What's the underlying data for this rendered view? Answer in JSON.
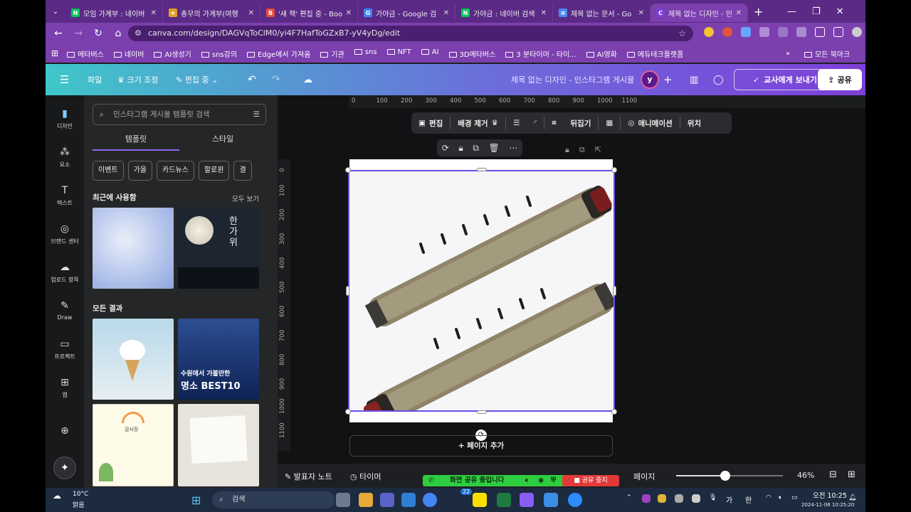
{
  "browser": {
    "tabs": [
      {
        "title": "모임 가계부 : 네이버",
        "fav": "N",
        "color": "#03c75a",
        "active": false
      },
      {
        "title": "총무의 가계부(여행",
        "fav": "★",
        "color": "#e0a020",
        "active": false
      },
      {
        "title": "'새 책' 편집 중 - Boo",
        "fav": "B",
        "color": "#e74c3c",
        "active": false
      },
      {
        "title": "가야금 - Google 검",
        "fav": "G",
        "color": "#4285f4",
        "active": false
      },
      {
        "title": "가야금 : 네이버 검색",
        "fav": "N",
        "color": "#03c75a",
        "active": false
      },
      {
        "title": "제목 없는 문서 - Go",
        "fav": "≡",
        "color": "#4a8af4",
        "active": false
      },
      {
        "title": "제목 없는 디자인 - 인",
        "fav": "C",
        "color": "#7d3fd8",
        "active": true
      }
    ],
    "new_tab_label": "+",
    "url": "canva.com/design/DAGVqToClM0/yi4F7HafToGZxB7-yV4yDg/edit",
    "bookmarks": [
      "메타버스",
      "네이버",
      "AI생성기",
      "sns강의",
      "Edge에서 가져옴",
      "기관",
      "sns",
      "NFT",
      "AI",
      "3D메타버스",
      "3 분타이머 - 타이...",
      "AI영화",
      "에듀테크플랫폼"
    ],
    "all_bookmarks": "모든 북마크",
    "more_bookmarks": "»"
  },
  "canva_header": {
    "menu_icon": "hamburger-icon",
    "file": "파일",
    "resize": "크기 조정",
    "editing": "편집 중",
    "doc_title": "제목 없는 디자인 - 인스타그램 게시물",
    "avatar_letter": "y",
    "plus": "+",
    "send_teacher": "교사에게 보내기",
    "share": "공유"
  },
  "rail": [
    {
      "label": "디자인",
      "icon": "design-icon"
    },
    {
      "label": "요소",
      "icon": "elements-icon"
    },
    {
      "label": "텍스트",
      "icon": "text-icon"
    },
    {
      "label": "브랜드 센터",
      "icon": "brand-icon"
    },
    {
      "label": "업로드 항목",
      "icon": "upload-icon"
    },
    {
      "label": "Draw",
      "icon": "draw-icon"
    },
    {
      "label": "프로젝트",
      "icon": "folder-icon"
    },
    {
      "label": "앱",
      "icon": "apps-icon"
    }
  ],
  "panel": {
    "search_placeholder": "인스타그램 게시물 템플릿 검색",
    "tab_templates": "템플릿",
    "tab_styles": "스타일",
    "chips": [
      "이벤트",
      "가을",
      "카드뉴스",
      "할로윈",
      "결"
    ],
    "recent_title": "최근에 사용함",
    "see_all": "모두 보기",
    "all_results": "모든 결과",
    "thumb_hangawi": "한가위",
    "thumb_suwon_line1": "수원에서 가볼만한",
    "thumb_suwon_line2": "명소 BEST10",
    "thumb_thanks": "감사장"
  },
  "canvas": {
    "ruler_h": [
      "0",
      "100",
      "200",
      "300",
      "400",
      "500",
      "600",
      "700",
      "800",
      "900",
      "1000",
      "1100"
    ],
    "ruler_v": [
      "0",
      "100",
      "200",
      "300",
      "400",
      "500",
      "600",
      "700",
      "800",
      "900",
      "1000",
      "1100"
    ],
    "toolbar": {
      "edit": "편집",
      "remove_bg": "배경 제거",
      "flip": "뒤집기",
      "animate": "애니메이션",
      "position": "위치"
    },
    "add_page": "+ 페이지 추가"
  },
  "bottom": {
    "notes": "발표자 노트",
    "timer": "타이머",
    "pages": "페이지",
    "zoom": "46%",
    "zoom_level": 0.46,
    "screen_share": "화면 공유 중입니다",
    "stop_share": "공유 중지"
  },
  "taskbar": {
    "weather_temp": "10°C",
    "weather_desc": "맑음",
    "search": "검색",
    "ime1": "가",
    "ime2": "한",
    "time": "오전 10:25",
    "stamp": "2024-11-06 10:25:20",
    "badge": "22"
  }
}
